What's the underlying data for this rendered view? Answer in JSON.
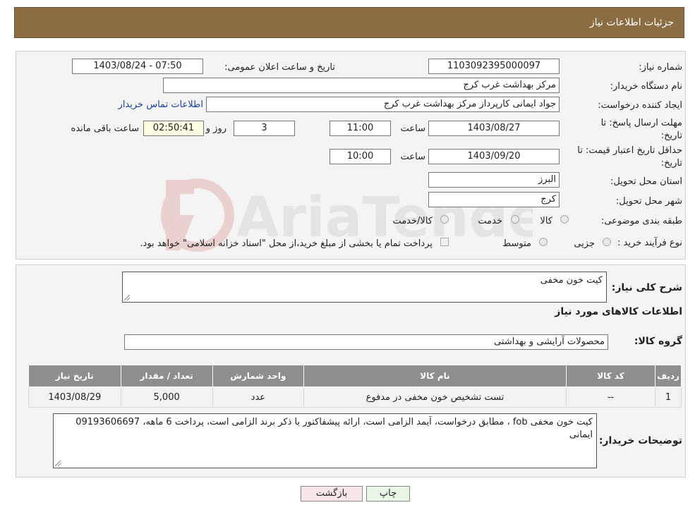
{
  "header": {
    "title": "جزئیات اطلاعات نیاز"
  },
  "form": {
    "need_number_label": "شماره نیاز:",
    "need_number": "1103092395000097",
    "announce_label": "تاریخ و ساعت اعلان عمومی:",
    "announce_value": "1403/08/24 - 07:50",
    "buyer_org_label": "نام دستگاه خریدار:",
    "buyer_org": "مرکز بهداشت غرب کرج",
    "creator_label": "ایجاد کننده درخواست:",
    "creator": "جواد ایمانی کارپرداز مرکز بهداشت غرب کرج",
    "contact_link": "اطلاعات تماس خریدار",
    "deadline_label": "مهلت ارسال پاسخ: تا تاریخ:",
    "deadline_date": "1403/08/27",
    "time_label": "ساعت",
    "deadline_time": "11:00",
    "days_value": "3",
    "days_label": "روز و",
    "remaining_value": "02:50:41",
    "remaining_label": "ساعت باقی مانده",
    "validity_label": "حداقل تاریخ اعتبار قیمت: تا تاریخ:",
    "validity_date": "1403/09/20",
    "validity_time": "10:00",
    "province_label": "استان محل تحویل:",
    "province": "البرز",
    "city_label": "شهر محل تحویل:",
    "city": "کرج",
    "category_label": "طبقه بندی موضوعی:",
    "category_options": [
      "کالا",
      "خدمت",
      "کالا/خدمت"
    ],
    "process_label": "نوع فرآیند خرید :",
    "process_options": [
      "جزیی",
      "متوسط"
    ],
    "payment_note": "پرداخت تمام یا بخشی از مبلغ خرید،از محل \"اسناد خزانه اسلامی\" خواهد بود."
  },
  "summary": {
    "label": "شرح کلی نیاز:",
    "value": "کیت خون مخفی",
    "goods_info_title": "اطلاعات کالاهای مورد نیاز",
    "group_label": "گروه کالا:",
    "group_value": "محصولات آرایشی و بهداشتی"
  },
  "table": {
    "headers": [
      "ردیف",
      "کد کالا",
      "نام کالا",
      "واحد شمارش",
      "تعداد / مقدار",
      "تاریخ نیاز"
    ],
    "rows": [
      [
        "1",
        "--",
        "تست تشخیص خون مخفی در مدفوع",
        "عدد",
        "5,000",
        "1403/08/29"
      ]
    ]
  },
  "notes": {
    "label": "توضیحات خریدار:",
    "value": "کیت خون مخفی fob ، مطابق درخواست، آیمد الزامی است، ارائه پیشفاکتور با ذکر برند الزامی است، پرداخت 6 ماهه، 09193606697 ایمانی"
  },
  "buttons": {
    "print": "چاپ",
    "back": "بازگشت"
  },
  "colors": {
    "header": "#8c6c42",
    "print_bg": "#eaf7e6",
    "back_bg": "#fbe7e7"
  }
}
